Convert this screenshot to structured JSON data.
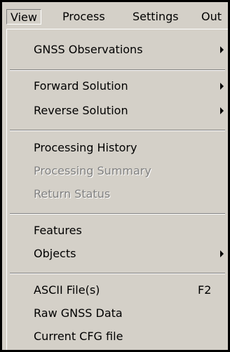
{
  "menubar": {
    "items": [
      {
        "label": "View"
      },
      {
        "label": "Process"
      },
      {
        "label": "Settings"
      },
      {
        "label": "Out"
      }
    ]
  },
  "dropdown": {
    "groups": [
      [
        {
          "label": "GNSS Observations",
          "submenu_icon": "submenu-arrow-icon"
        }
      ],
      [
        {
          "label": "Forward Solution",
          "submenu_icon": "submenu-arrow-icon"
        },
        {
          "label": "Reverse Solution",
          "submenu_icon": "submenu-arrow-icon"
        }
      ],
      [
        {
          "label": "Processing History"
        },
        {
          "label": "Processing Summary",
          "disabled": true
        },
        {
          "label": "Return Status",
          "disabled": true
        }
      ],
      [
        {
          "label": "Features"
        },
        {
          "label": "Objects",
          "submenu_icon": "submenu-arrow-icon"
        }
      ],
      [
        {
          "label": "ASCII File(s)",
          "shortcut": "F2"
        },
        {
          "label": "Raw GNSS Data"
        },
        {
          "label": "Current CFG file"
        }
      ]
    ]
  },
  "colors": {
    "menu_background": "#d4d0c8",
    "border": "#000000",
    "disabled_text": "#808080"
  }
}
